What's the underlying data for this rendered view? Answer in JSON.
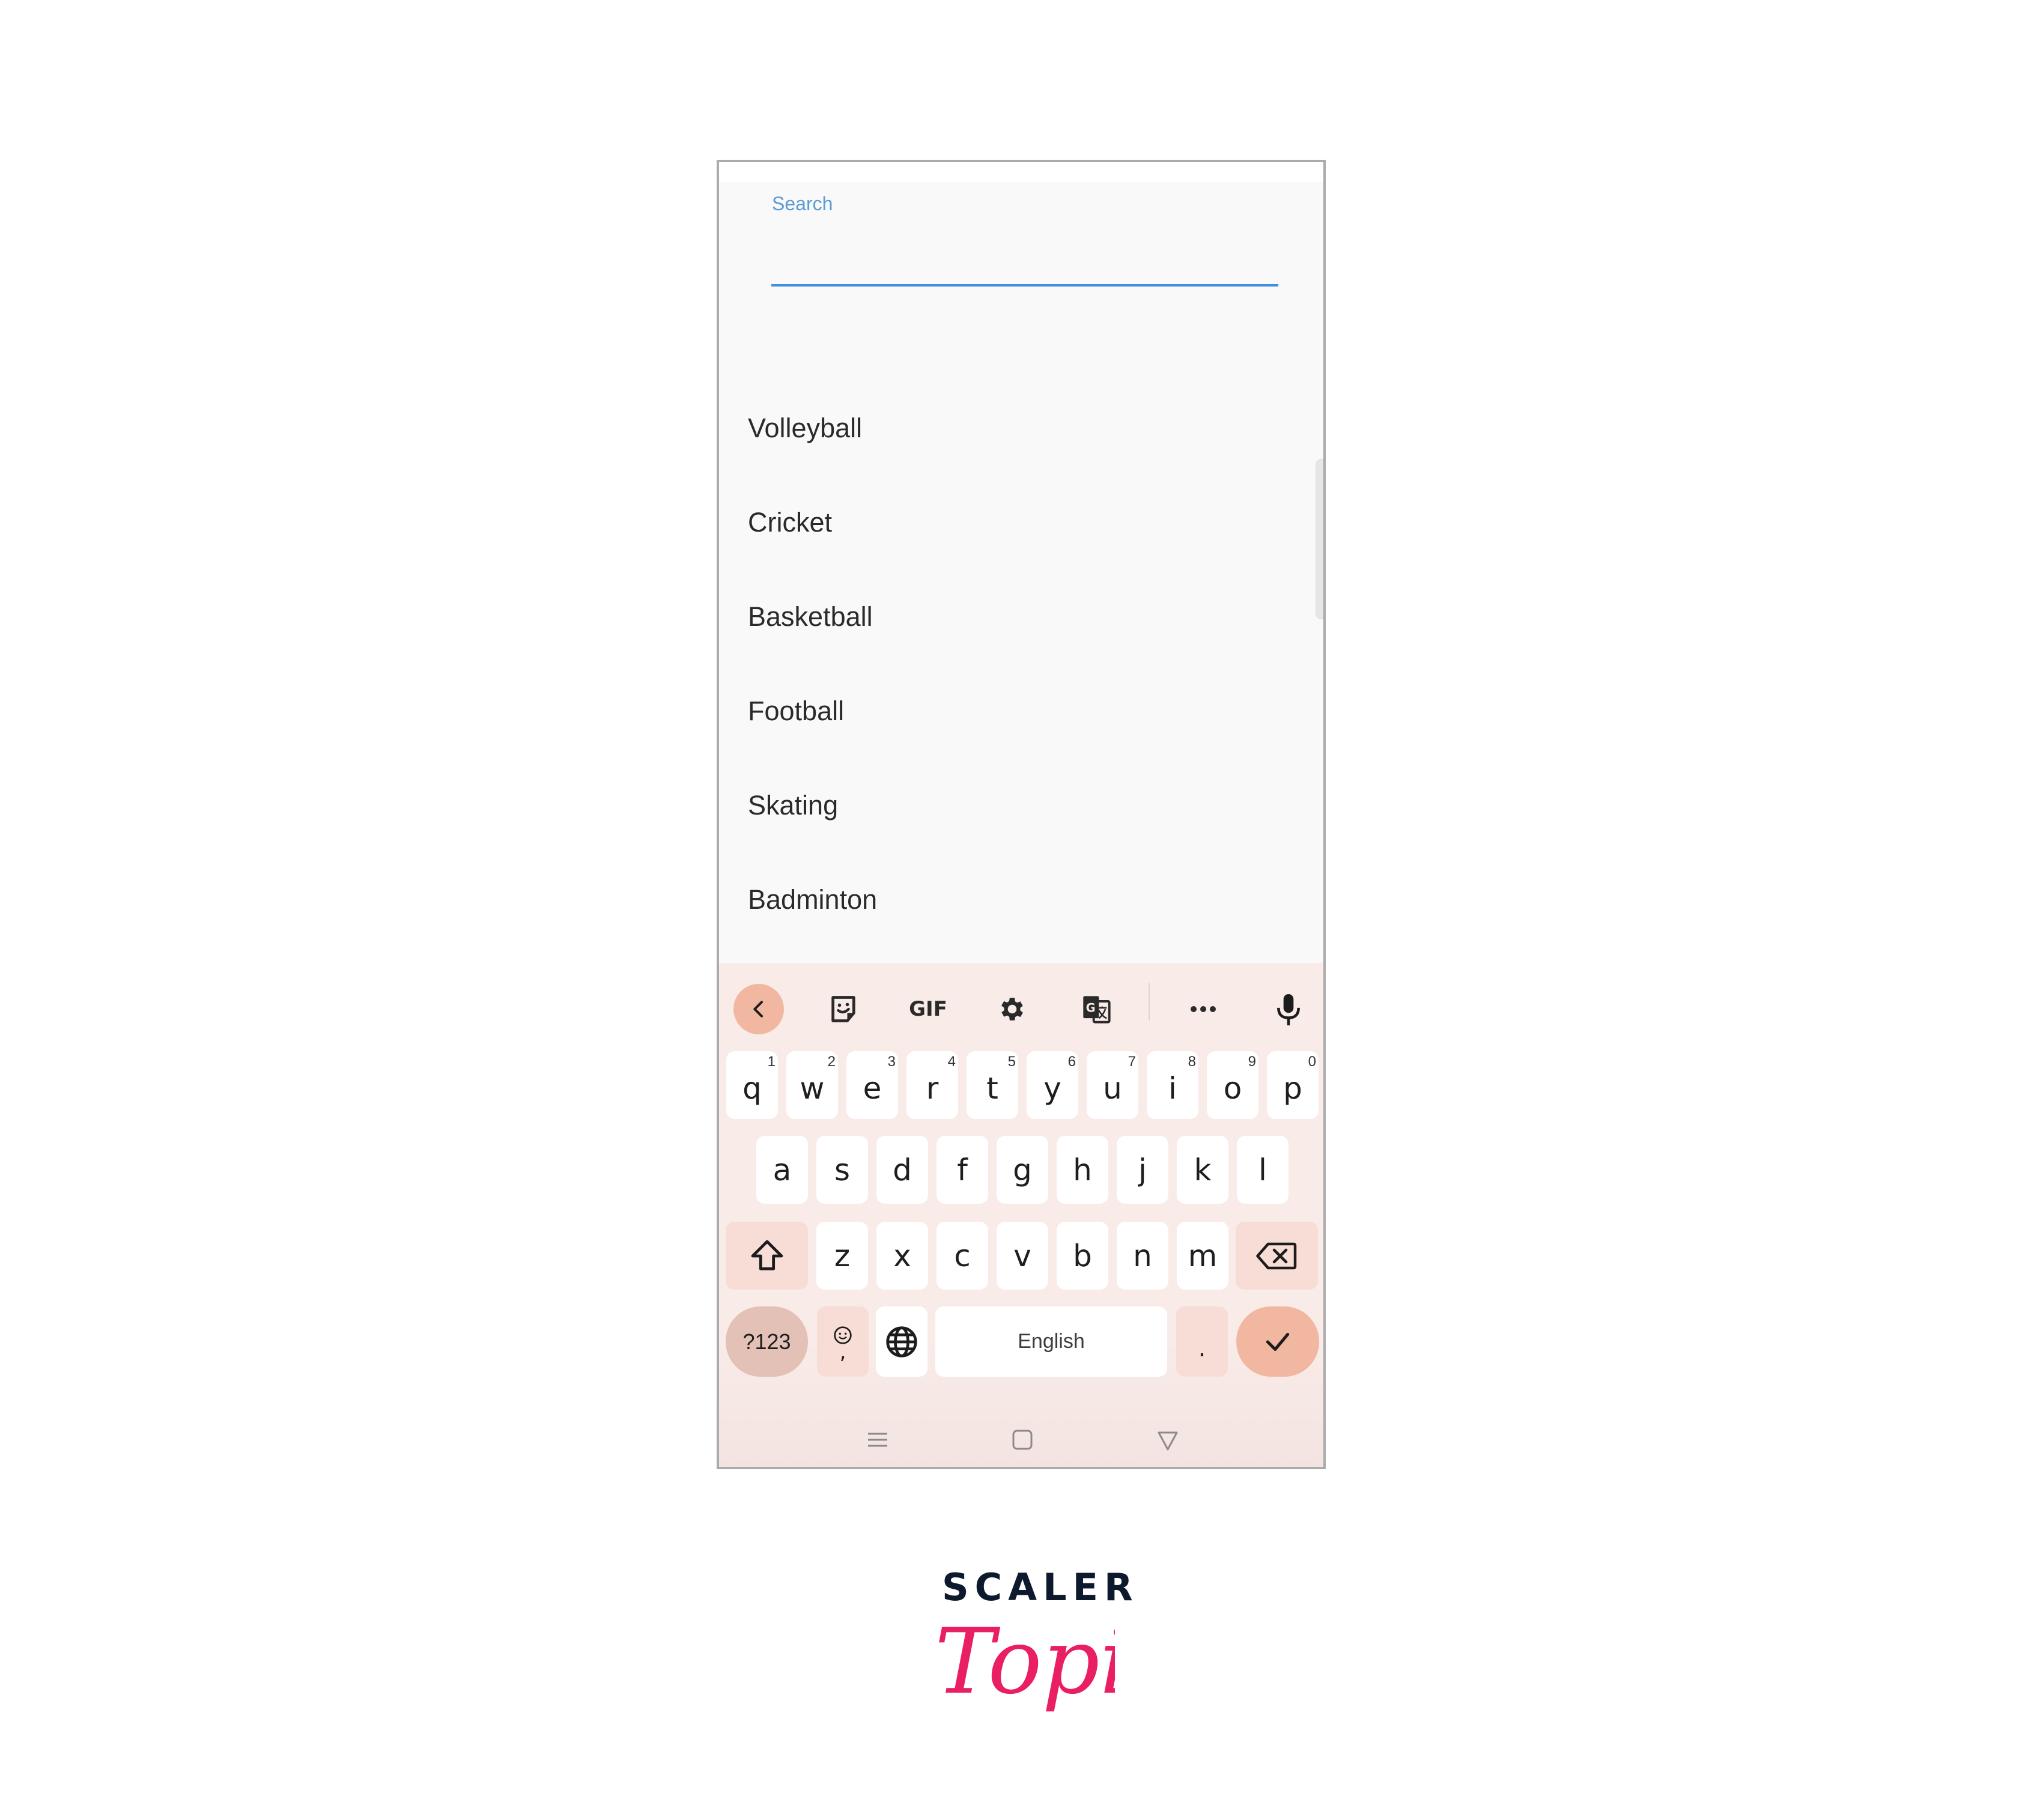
{
  "search": {
    "label": "Search",
    "value": "",
    "placeholder": ""
  },
  "list": {
    "items": [
      "Volleyball",
      "Cricket",
      "Basketball",
      "Football",
      "Skating",
      "Badminton"
    ]
  },
  "keyboard": {
    "toolbar": {
      "back_icon": "chevron-left-icon",
      "sticker_icon": "sticker-icon",
      "gif_label": "GIF",
      "settings_icon": "gear-icon",
      "translate_icon": "translate-icon",
      "more_icon": "more-horizontal-icon",
      "mic_icon": "microphone-icon"
    },
    "row1": [
      {
        "key": "q",
        "hint": "1"
      },
      {
        "key": "w",
        "hint": "2"
      },
      {
        "key": "e",
        "hint": "3"
      },
      {
        "key": "r",
        "hint": "4"
      },
      {
        "key": "t",
        "hint": "5"
      },
      {
        "key": "y",
        "hint": "6"
      },
      {
        "key": "u",
        "hint": "7"
      },
      {
        "key": "i",
        "hint": "8"
      },
      {
        "key": "o",
        "hint": "9"
      },
      {
        "key": "p",
        "hint": "0"
      }
    ],
    "row2": [
      "a",
      "s",
      "d",
      "f",
      "g",
      "h",
      "j",
      "k",
      "l"
    ],
    "row3": [
      "z",
      "x",
      "c",
      "v",
      "b",
      "n",
      "m"
    ],
    "symbols_label": "?123",
    "comma_label": ",",
    "space_label": "English",
    "period_label": ".",
    "colors": {
      "background": "#f9ebe8",
      "accent": "#f2b7a0",
      "modifier": "#f8ddd6",
      "symbols": "#e4c1b6"
    }
  },
  "navbar": {
    "recents_icon": "recents-icon",
    "home_icon": "home-icon",
    "back_icon": "back-triangle-icon"
  },
  "brand": {
    "line1": "SCALER",
    "line2": "Topics",
    "color_dark": "#0d1a2d",
    "color_accent": "#e91e63"
  }
}
